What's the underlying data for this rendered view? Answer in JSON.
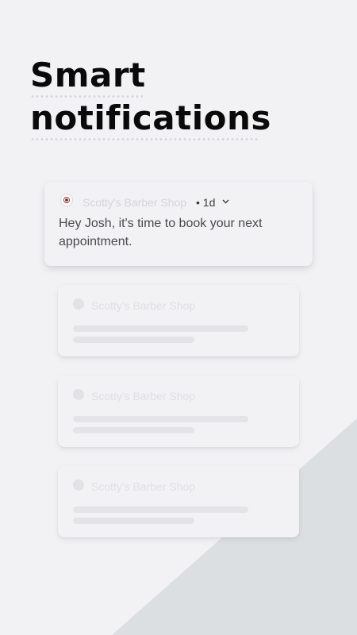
{
  "headline": {
    "line1": "Smart",
    "line2": "notifications"
  },
  "notification": {
    "app_name": "Scotty's Barber Shop",
    "time": "• 1d",
    "message": "Hey Josh, it's time to book your next appointment.",
    "icon": "barber-shop-logo-icon"
  },
  "ghost_cards": [
    {
      "app_name": "Scotty's Barber Shop"
    },
    {
      "app_name": "Scotty's Barber Shop"
    },
    {
      "app_name": "Scotty's Barber Shop"
    }
  ],
  "colors": {
    "background": "#f2f2f5",
    "accent_shape": "#dcdfe2",
    "headline": "#0a0a0a"
  }
}
